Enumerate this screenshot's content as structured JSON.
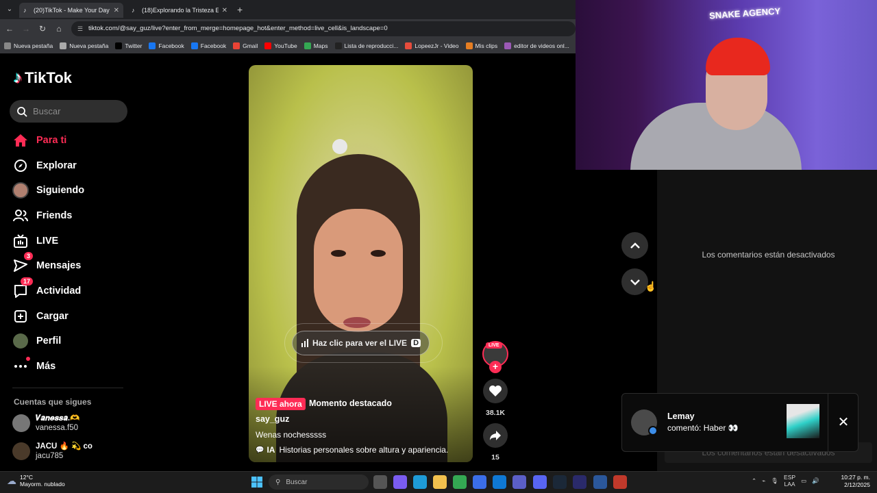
{
  "browser": {
    "tabs": [
      {
        "title": "(20)TikTok - Make Your Day",
        "active": true
      },
      {
        "title": "(18)Explorando la Tristeza Emo",
        "active": false
      }
    ],
    "url": "tiktok.com/@say_guz/live?enter_from_merge=homepage_hot&enter_method=live_cell&is_landscape=0",
    "bookmarks": [
      {
        "label": "Nueva pestaña",
        "color": "#888"
      },
      {
        "label": "Nueva pestaña",
        "color": "#aaa"
      },
      {
        "label": "Twitter",
        "color": "#000"
      },
      {
        "label": "Facebook",
        "color": "#1877f2"
      },
      {
        "label": "Facebook",
        "color": "#1877f2"
      },
      {
        "label": "Gmail",
        "color": "#ea4335"
      },
      {
        "label": "YouTube",
        "color": "#ff0000"
      },
      {
        "label": "Maps",
        "color": "#34a853"
      },
      {
        "label": "Lista de reproducci...",
        "color": "#222"
      },
      {
        "label": "LopeezJr - Video",
        "color": "#e74c3c"
      },
      {
        "label": "Mis clips",
        "color": "#e67e22"
      },
      {
        "label": "editor de videos onl...",
        "color": "#9b59b6"
      }
    ]
  },
  "tiktok": {
    "logo": "TikTok",
    "search_placeholder": "Buscar",
    "nav": [
      {
        "label": "Para ti",
        "icon": "home-icon",
        "active": true
      },
      {
        "label": "Explorar",
        "icon": "compass-icon"
      },
      {
        "label": "Siguiendo",
        "icon": "following-avatar-icon"
      },
      {
        "label": "Friends",
        "icon": "friends-icon"
      },
      {
        "label": "LIVE",
        "icon": "live-tv-icon"
      },
      {
        "label": "Mensajes",
        "icon": "messages-icon",
        "badge": "3"
      },
      {
        "label": "Actividad",
        "icon": "activity-icon",
        "badge": "17"
      },
      {
        "label": "Cargar",
        "icon": "upload-icon"
      },
      {
        "label": "Perfil",
        "icon": "profile-avatar-icon"
      },
      {
        "label": "Más",
        "icon": "more-icon",
        "dot": true
      }
    ],
    "following_title": "Cuentas que sigues",
    "following": [
      {
        "name": "𝑽𝒂𝒏𝒆𝒔𝒔𝒂.🫶",
        "handle": "vanessa.f50"
      },
      {
        "name": "JACU 🔥 💫 co",
        "handle": "jacu785"
      }
    ]
  },
  "video": {
    "live_button": "Haz clic para ver el LIVE",
    "live_button_key": "D",
    "live_badge": "LIVE ahora",
    "highlight": "Momento destacado",
    "author": "say_guz",
    "caption": "Wenas nochesssss",
    "ai_label": "IA",
    "ai_text": "Historias personales sobre altura y apariencia.",
    "live_tag": "LIVE",
    "likes": "38.1K",
    "shares": "15"
  },
  "comments": {
    "disabled_text": "Los comentarios están desactivados"
  },
  "notification": {
    "user": "Lemay",
    "text": "comentó: Haber 👀"
  },
  "webcam": {
    "sign": "SNAKE AGENCY"
  },
  "taskbar": {
    "weather_temp": "12°C",
    "weather_desc": "Mayorm. nublado",
    "search": "Buscar",
    "lang1": "ESP",
    "lang2": "LAA",
    "time": "10:27 p. m.",
    "date": "2/12/2025"
  }
}
